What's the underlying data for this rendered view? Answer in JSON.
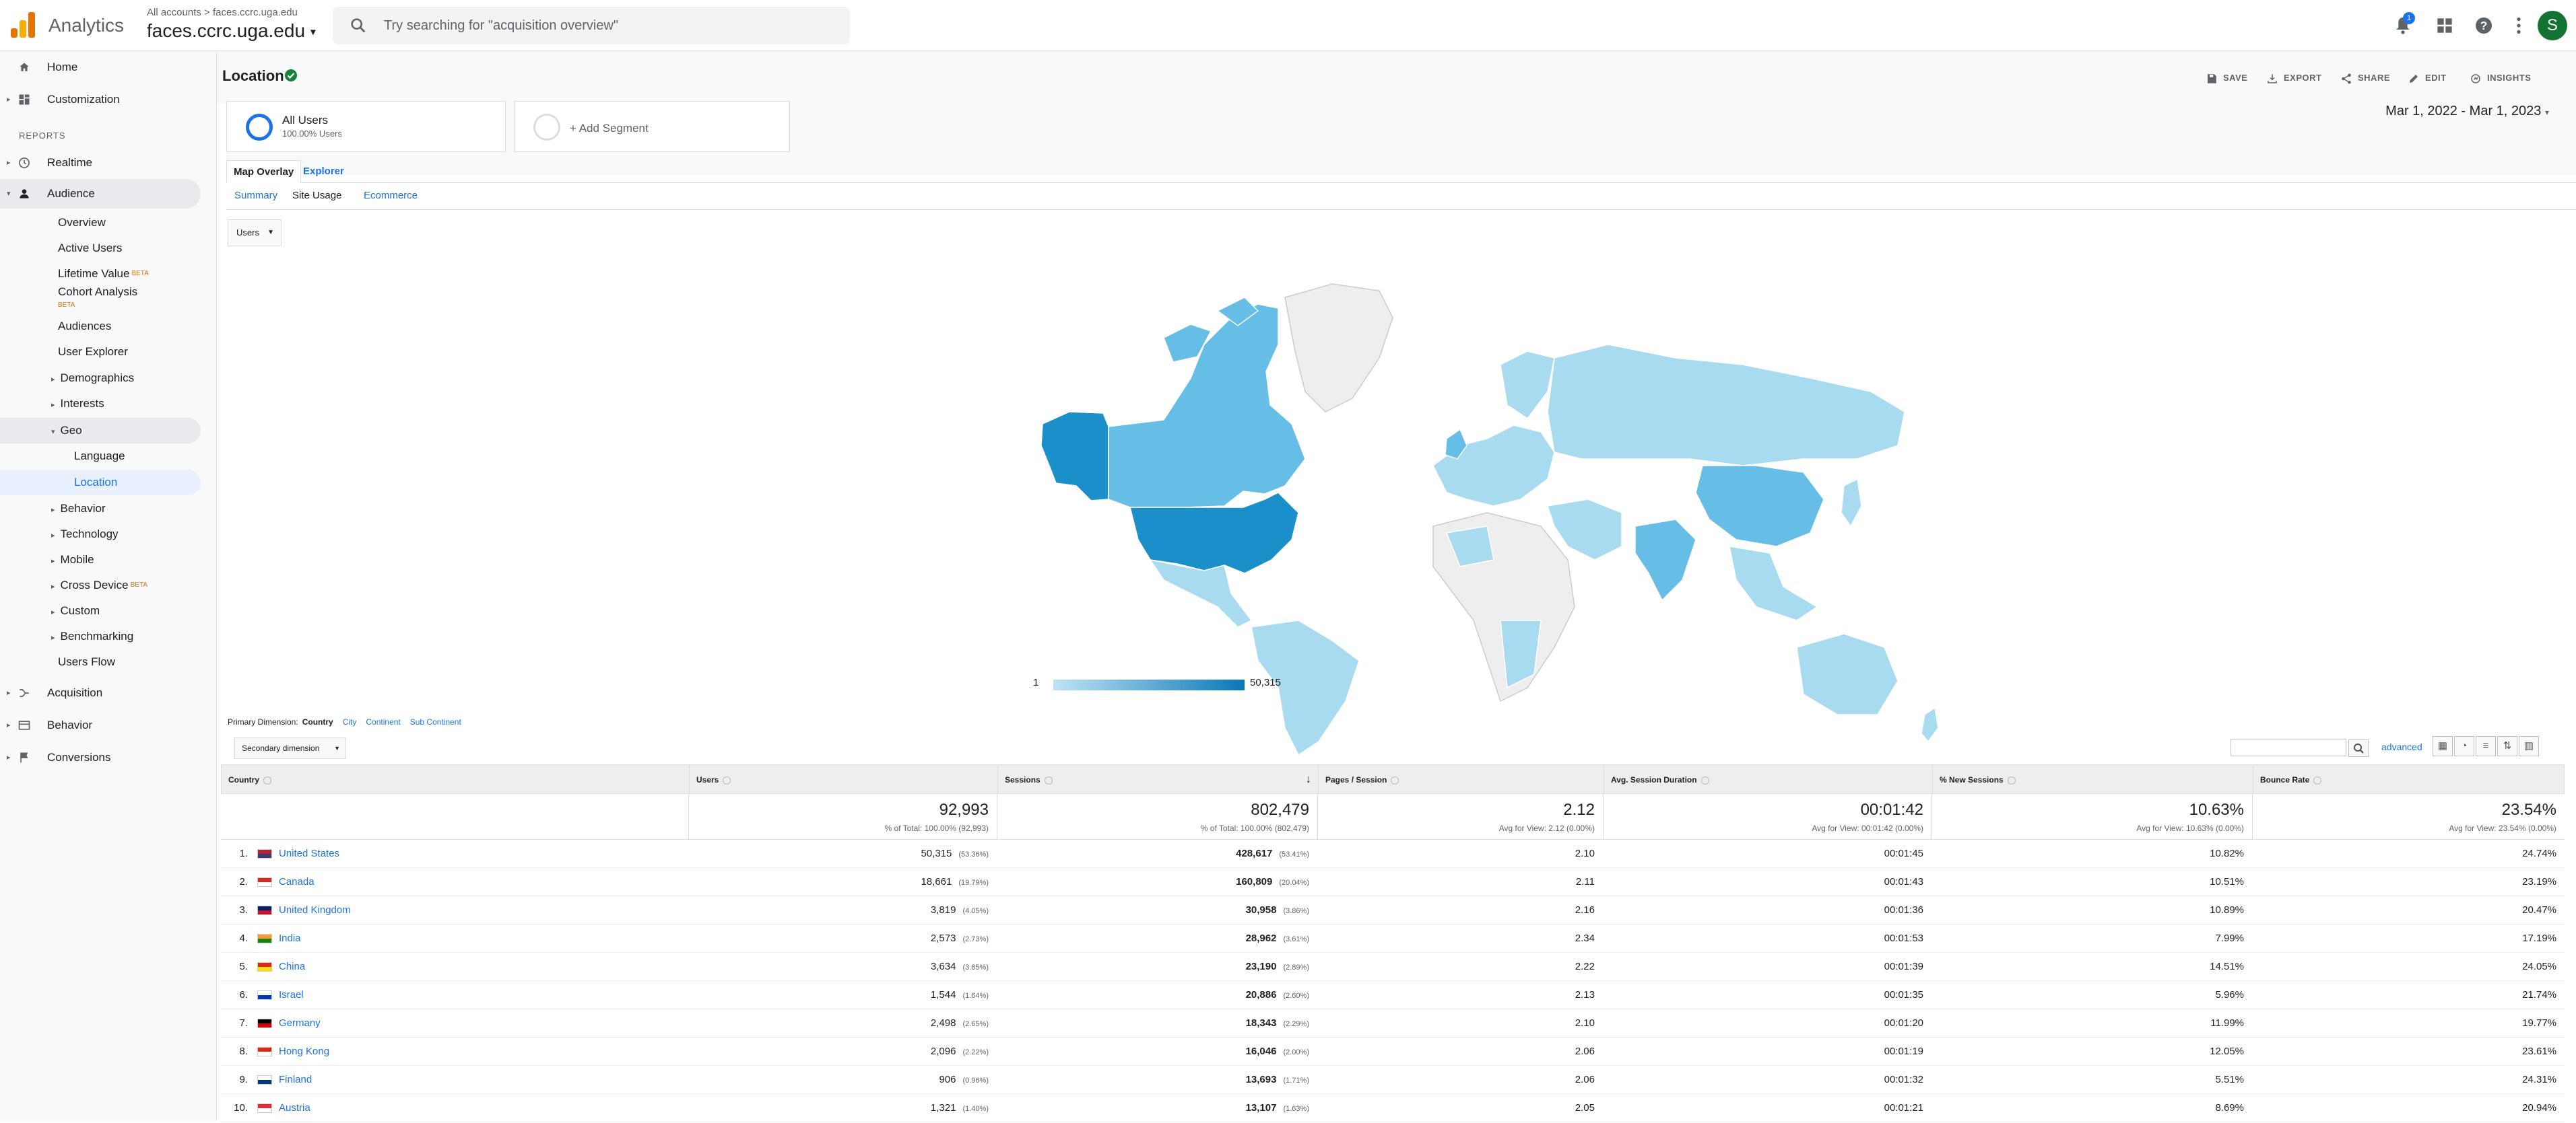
{
  "topbar": {
    "app_name": "Analytics",
    "crumb_all": "All accounts",
    "crumb_sep": ">",
    "crumb_property": "faces.ccrc.uga.edu",
    "account_name": "faces.ccrc.uga.edu",
    "search_placeholder": "Try searching for \"acquisition overview\"",
    "notification_count": "1",
    "avatar_letter": "S"
  },
  "sidebar": {
    "home": "Home",
    "customization": "Customization",
    "reports_label": "REPORTS",
    "realtime": "Realtime",
    "audience": "Audience",
    "audience_items": [
      "Overview",
      "Active Users",
      "Lifetime Value",
      "Cohort Analysis",
      "Audiences",
      "User Explorer",
      "Demographics",
      "Interests",
      "Geo"
    ],
    "beta": "BETA",
    "geo_items": [
      "Language",
      "Location"
    ],
    "more_items": [
      "Behavior",
      "Technology",
      "Mobile",
      "Cross Device",
      "Custom",
      "Benchmarking",
      "Users Flow"
    ],
    "acquisition": "Acquisition",
    "behavior": "Behavior",
    "conversions": "Conversions"
  },
  "header": {
    "title": "Location",
    "actions": [
      "SAVE",
      "EXPORT",
      "SHARE",
      "EDIT",
      "INSIGHTS"
    ]
  },
  "segments": {
    "all_users": "All Users",
    "all_users_sub": "100.00% Users",
    "add_segment": "+ Add Segment",
    "date_range": "Mar 1, 2022 - Mar 1, 2023"
  },
  "tabs": [
    "Map Overlay",
    "Explorer"
  ],
  "subtabs": [
    "Summary",
    "Site Usage",
    "Ecommerce"
  ],
  "metric_dropdown": "Users",
  "map_legend": {
    "min": "1",
    "max": "50,315"
  },
  "primary_dimension": {
    "label": "Primary Dimension:",
    "selected": "Country",
    "options": [
      "City",
      "Continent",
      "Sub Continent"
    ]
  },
  "secondary_dimension": "Secondary dimension",
  "advanced": "advanced",
  "table": {
    "columns": [
      "Country",
      "Users",
      "Sessions",
      "Pages / Session",
      "Avg. Session Duration",
      "% New Sessions",
      "Bounce Rate"
    ],
    "totals": [
      {
        "big": "92,993",
        "small": "% of Total: 100.00% (92,993)"
      },
      {
        "big": "802,479",
        "small": "% of Total: 100.00% (802,479)"
      },
      {
        "big": "2.12",
        "small": "Avg for View: 2.12 (0.00%)"
      },
      {
        "big": "00:01:42",
        "small": "Avg for View: 00:01:42 (0.00%)"
      },
      {
        "big": "10.63%",
        "small": "Avg for View: 10.63% (0.00%)"
      },
      {
        "big": "23.54%",
        "small": "Avg for View: 23.54% (0.00%)"
      }
    ],
    "rows": [
      {
        "idx": "1.",
        "country": "United States",
        "users": "50,315",
        "users_pct": "(53.36%)",
        "sessions": "428,617",
        "sessions_pct": "(53.41%)",
        "pps": "2.10",
        "dur": "00:01:45",
        "new": "10.82%",
        "bounce": "24.74%"
      },
      {
        "idx": "2.",
        "country": "Canada",
        "users": "18,661",
        "users_pct": "(19.79%)",
        "sessions": "160,809",
        "sessions_pct": "(20.04%)",
        "pps": "2.11",
        "dur": "00:01:43",
        "new": "10.51%",
        "bounce": "23.19%"
      },
      {
        "idx": "3.",
        "country": "United Kingdom",
        "users": "3,819",
        "users_pct": "(4.05%)",
        "sessions": "30,958",
        "sessions_pct": "(3.86%)",
        "pps": "2.16",
        "dur": "00:01:36",
        "new": "10.89%",
        "bounce": "20.47%"
      },
      {
        "idx": "4.",
        "country": "India",
        "users": "2,573",
        "users_pct": "(2.73%)",
        "sessions": "28,962",
        "sessions_pct": "(3.61%)",
        "pps": "2.34",
        "dur": "00:01:53",
        "new": "7.99%",
        "bounce": "17.19%"
      },
      {
        "idx": "5.",
        "country": "China",
        "users": "3,634",
        "users_pct": "(3.85%)",
        "sessions": "23,190",
        "sessions_pct": "(2.89%)",
        "pps": "2.22",
        "dur": "00:01:39",
        "new": "14.51%",
        "bounce": "24.05%"
      },
      {
        "idx": "6.",
        "country": "Israel",
        "users": "1,544",
        "users_pct": "(1.64%)",
        "sessions": "20,886",
        "sessions_pct": "(2.60%)",
        "pps": "2.13",
        "dur": "00:01:35",
        "new": "5.96%",
        "bounce": "21.74%"
      },
      {
        "idx": "7.",
        "country": "Germany",
        "users": "2,498",
        "users_pct": "(2.65%)",
        "sessions": "18,343",
        "sessions_pct": "(2.29%)",
        "pps": "2.10",
        "dur": "00:01:20",
        "new": "11.99%",
        "bounce": "19.77%"
      },
      {
        "idx": "8.",
        "country": "Hong Kong",
        "users": "2,096",
        "users_pct": "(2.22%)",
        "sessions": "16,046",
        "sessions_pct": "(2.00%)",
        "pps": "2.06",
        "dur": "00:01:19",
        "new": "12.05%",
        "bounce": "23.61%"
      },
      {
        "idx": "9.",
        "country": "Finland",
        "users": "906",
        "users_pct": "(0.96%)",
        "sessions": "13,693",
        "sessions_pct": "(1.71%)",
        "pps": "2.06",
        "dur": "00:01:32",
        "new": "5.51%",
        "bounce": "24.31%"
      },
      {
        "idx": "10.",
        "country": "Austria",
        "users": "1,321",
        "users_pct": "(1.40%)",
        "sessions": "13,107",
        "sessions_pct": "(1.63%)",
        "pps": "2.05",
        "dur": "00:01:21",
        "new": "8.69%",
        "bounce": "20.94%"
      }
    ]
  },
  "colors": {
    "accent": "#1a73e8",
    "map_dark": "#1a8fc9",
    "map_mid": "#66bde6",
    "map_light": "#a8daf0",
    "map_none": "#eeeeee"
  }
}
